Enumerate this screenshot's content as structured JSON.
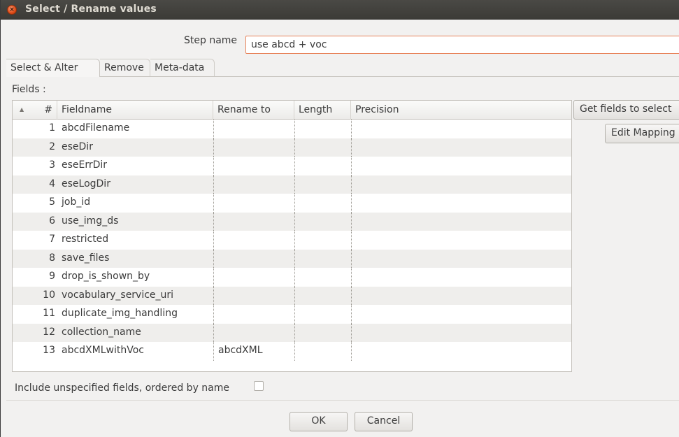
{
  "window": {
    "title": "Select / Rename values",
    "close_glyph": "×"
  },
  "step": {
    "label": "Step name",
    "value": "use abcd + voc"
  },
  "tabs": [
    {
      "label": "Select & Alter",
      "active": true
    },
    {
      "label": "Remove",
      "active": false
    },
    {
      "label": "Meta-data",
      "active": false
    }
  ],
  "fields_label": "Fields :",
  "table": {
    "sort_glyph": "▲",
    "headers": {
      "num": "#",
      "fieldname": "Fieldname",
      "rename": "Rename to",
      "length": "Length",
      "precision": "Precision"
    },
    "rows": [
      {
        "num": "1",
        "fieldname": "abcdFilename",
        "rename": "",
        "length": "",
        "precision": ""
      },
      {
        "num": "2",
        "fieldname": "eseDir",
        "rename": "",
        "length": "",
        "precision": ""
      },
      {
        "num": "3",
        "fieldname": "eseErrDir",
        "rename": "",
        "length": "",
        "precision": ""
      },
      {
        "num": "4",
        "fieldname": "eseLogDir",
        "rename": "",
        "length": "",
        "precision": ""
      },
      {
        "num": "5",
        "fieldname": "job_id",
        "rename": "",
        "length": "",
        "precision": ""
      },
      {
        "num": "6",
        "fieldname": "use_img_ds",
        "rename": "",
        "length": "",
        "precision": ""
      },
      {
        "num": "7",
        "fieldname": "restricted",
        "rename": "",
        "length": "",
        "precision": ""
      },
      {
        "num": "8",
        "fieldname": "save_files",
        "rename": "",
        "length": "",
        "precision": ""
      },
      {
        "num": "9",
        "fieldname": "drop_is_shown_by",
        "rename": "",
        "length": "",
        "precision": ""
      },
      {
        "num": "10",
        "fieldname": "vocabulary_service_uri",
        "rename": "",
        "length": "",
        "precision": ""
      },
      {
        "num": "11",
        "fieldname": "duplicate_img_handling",
        "rename": "",
        "length": "",
        "precision": ""
      },
      {
        "num": "12",
        "fieldname": "collection_name",
        "rename": "",
        "length": "",
        "precision": ""
      },
      {
        "num": "13",
        "fieldname": "abcdXMLwithVoc",
        "rename": "abcdXML",
        "length": "",
        "precision": ""
      }
    ]
  },
  "buttons": {
    "get_fields": "Get fields to select",
    "edit_mapping": "Edit Mapping",
    "ok": "OK",
    "cancel": "Cancel"
  },
  "include_unspecified": {
    "label": "Include unspecified fields, ordered by name",
    "checked": false
  },
  "colors": {
    "titlebar": "#3c3b37",
    "dialog_bg": "#f2f1f0",
    "input_focus_border": "#e8835b",
    "close_button": "#df4a16"
  }
}
